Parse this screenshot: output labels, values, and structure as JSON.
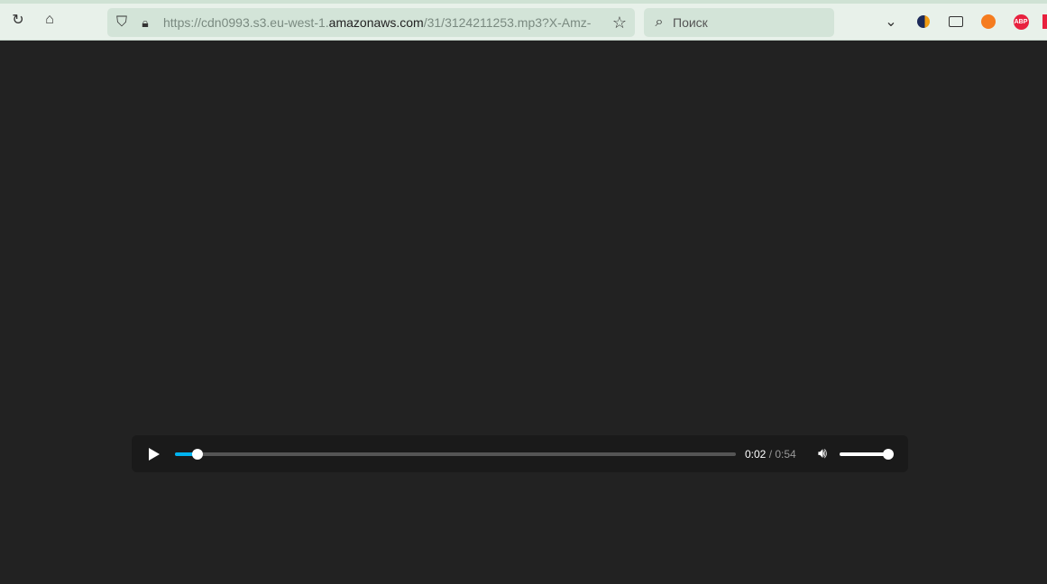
{
  "browser": {
    "url_prefix": "https://cdn0993.s3.eu-west-1.",
    "url_domain": "amazonaws.com",
    "url_suffix": "/31/3124211253.mp3?X-Amz-",
    "search_placeholder": "Поиск",
    "extensions": [
      "pocket-icon",
      "extension-icon",
      "reader-view-icon",
      "extension-orange-icon",
      "adblock-plus-icon"
    ],
    "abp_label": "ABP"
  },
  "player": {
    "current_time": "0:02",
    "separator": " / ",
    "duration": "0:54",
    "progress_fraction": 0.04,
    "volume_fraction": 1.0,
    "progress_color": "#00b3f0"
  }
}
